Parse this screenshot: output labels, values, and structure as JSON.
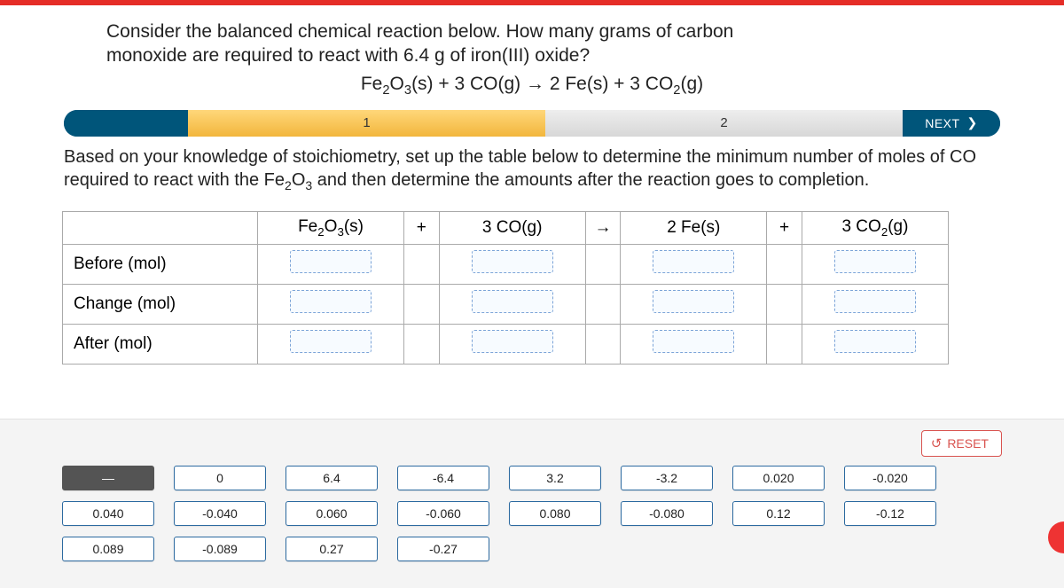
{
  "question_line1": "Consider the balanced chemical reaction below. How many grams of carbon",
  "question_line2": "monoxide are required to react with 6.4 g of iron(III) oxide?",
  "equation_plain": "Fe2O3(s) + 3 CO(g) → 2 Fe(s) + 3 CO2(g)",
  "steps": {
    "s1": "1",
    "s2": "2",
    "next": "NEXT"
  },
  "instructions_part1": "Based on your knowledge of stoichiometry, set up the table below to determine the minimum number of moles of CO required to react with the Fe",
  "instructions_sub1": "2",
  "instructions_mid": "O",
  "instructions_sub2": "3",
  "instructions_part2": " and then determine the amounts after the reaction goes to completion.",
  "table": {
    "rows": [
      "Before (mol)",
      "Change (mol)",
      "After (mol)"
    ],
    "species": {
      "fe2o3": "Fe2O3(s)",
      "co": "3 CO(g)",
      "fe": "2 Fe(s)",
      "co2": "3 CO2(g)"
    },
    "ops": {
      "plus": "+",
      "arrow": "→"
    }
  },
  "reset": "RESET",
  "tiles": {
    "row1": [
      "—",
      "0",
      "6.4",
      "-6.4",
      "3.2",
      "-3.2",
      "0.020",
      "-0.020"
    ],
    "row2": [
      "0.040",
      "-0.040",
      "0.060",
      "-0.060",
      "0.080",
      "-0.080",
      "0.12",
      "-0.12"
    ],
    "row3": [
      "0.089",
      "-0.089",
      "0.27",
      "-0.27"
    ]
  },
  "chart_data": {
    "type": "table",
    "title": "ICE table (stoichiometry drag-and-drop, unfilled)",
    "columns": [
      "Fe2O3(s)",
      "3 CO(g)",
      "2 Fe(s)",
      "3 CO2(g)"
    ],
    "rows": [
      "Before (mol)",
      "Change (mol)",
      "After (mol)"
    ],
    "cells": [
      [
        null,
        null,
        null,
        null
      ],
      [
        null,
        null,
        null,
        null
      ],
      [
        null,
        null,
        null,
        null
      ]
    ],
    "available_values": [
      "—",
      "0",
      "6.4",
      "-6.4",
      "3.2",
      "-3.2",
      "0.020",
      "-0.020",
      "0.040",
      "-0.040",
      "0.060",
      "-0.060",
      "0.080",
      "-0.080",
      "0.12",
      "-0.12",
      "0.089",
      "-0.089",
      "0.27",
      "-0.27"
    ]
  }
}
